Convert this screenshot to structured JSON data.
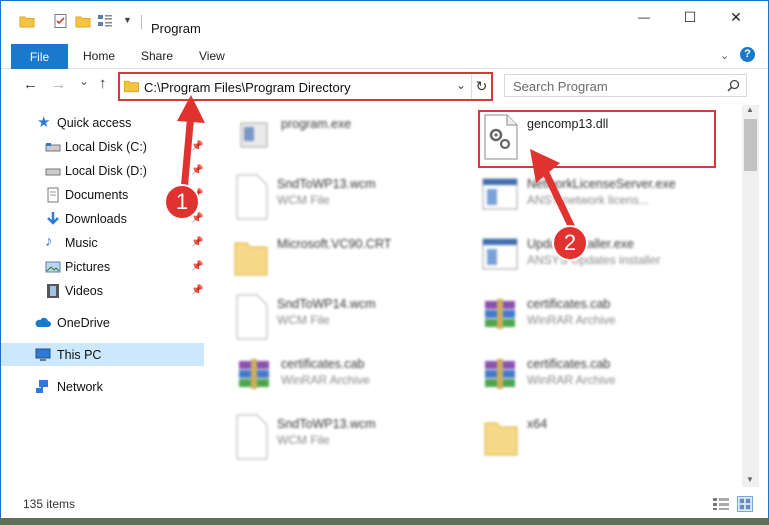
{
  "window": {
    "title": "Program",
    "minimize_glyph": "—",
    "maximize_glyph": "☐",
    "close_glyph": "✕"
  },
  "ribbon": {
    "file_tab": "File",
    "tabs": [
      "Home",
      "Share",
      "View"
    ],
    "help_glyph": "?"
  },
  "nav": {
    "back_glyph": "←",
    "forward_glyph": "→",
    "recent_glyph": "⌄",
    "up_glyph": "↑",
    "address": "C:\\Program Files\\Program Directory",
    "refresh_glyph": "↻",
    "search_placeholder": "Search Program"
  },
  "sidebar": {
    "items": [
      {
        "label": "Quick access",
        "icon": "star-icon"
      },
      {
        "label": "Local Disk (C:)",
        "icon": "drive-icon",
        "pinned": true
      },
      {
        "label": "Local Disk (D:)",
        "icon": "drive-icon",
        "pinned": true
      },
      {
        "label": "Documents",
        "icon": "documents-icon",
        "pinned": true
      },
      {
        "label": "Downloads",
        "icon": "download-icon",
        "pinned": true
      },
      {
        "label": "Music",
        "icon": "music-icon",
        "pinned": true
      },
      {
        "label": "Pictures",
        "icon": "pictures-icon",
        "pinned": true
      },
      {
        "label": "Videos",
        "icon": "videos-icon",
        "pinned": true
      },
      {
        "label": "OneDrive",
        "icon": "cloud-icon"
      },
      {
        "label": "This PC",
        "icon": "computer-icon",
        "selected": true
      },
      {
        "label": "Network",
        "icon": "network-icon"
      }
    ]
  },
  "files": [
    {
      "name": "program.exe",
      "type": "",
      "icon": "exe-icon"
    },
    {
      "name": "gencomp13.dll",
      "type": "",
      "icon": "dll-gear-icon"
    },
    {
      "name": "SndToWP13.wcm",
      "type": "WCM File",
      "icon": "blank-file-icon"
    },
    {
      "name": "NetworkLicenseServer.exe",
      "type": "ANSY network licens...",
      "icon": "app-window-icon"
    },
    {
      "name": "Microsoft.VC90.CRT",
      "type": "",
      "icon": "folder-icon"
    },
    {
      "name": "UpdateInstaller.exe",
      "type": "ANSYS Updates installer",
      "icon": "app-window-icon"
    },
    {
      "name": "SndToWP14.wcm",
      "type": "WCM File",
      "icon": "blank-file-icon"
    },
    {
      "name": "certificates.cab",
      "type": "WinRAR Archive",
      "icon": "winrar-icon"
    },
    {
      "name": "certificates.cab",
      "type": "WinRAR Archive",
      "icon": "winrar-icon"
    },
    {
      "name": "certificates.cab",
      "type": "WinRAR Archive",
      "icon": "winrar-icon"
    },
    {
      "name": "SndToWP13.wcm",
      "type": "WCM File",
      "icon": "blank-file-icon"
    },
    {
      "name": "x64",
      "type": "",
      "icon": "folder-icon"
    }
  ],
  "status": {
    "item_count": "135 items"
  },
  "callouts": [
    "1",
    "2"
  ],
  "colors": {
    "accent": "#1979ca",
    "highlight_red": "#d33b3b",
    "selected_bg": "#cce8ff"
  }
}
